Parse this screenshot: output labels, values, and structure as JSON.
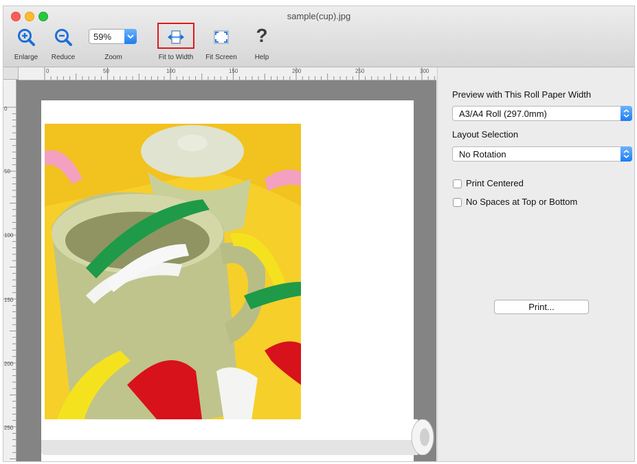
{
  "window": {
    "title": "sample(cup).jpg"
  },
  "toolbar": {
    "enlarge_label": "Enlarge",
    "reduce_label": "Reduce",
    "zoom_label": "Zoom",
    "zoom_value": "59%",
    "fit_width_label": "Fit to Width",
    "fit_screen_label": "Fit Screen",
    "help_label": "Help",
    "help_glyph": "?"
  },
  "rulers": {
    "horizontal": [
      "0",
      "50",
      "100",
      "150",
      "200",
      "250",
      "300"
    ],
    "vertical": [
      "0",
      "50",
      "100",
      "150",
      "200",
      "250"
    ]
  },
  "panel": {
    "roll_width_label": "Preview with This Roll Paper Width",
    "roll_width_value": "A3/A4 Roll (297.0mm)",
    "layout_label": "Layout Selection",
    "layout_value": "No Rotation",
    "print_centered_label": "Print Centered",
    "print_centered_checked": false,
    "no_spaces_label": "No Spaces at Top or Bottom",
    "no_spaces_checked": false,
    "print_button_label": "Print..."
  },
  "colors": {
    "accent": "#1d7cf2",
    "highlight_box": "#e2161c",
    "photo_background": "#f6cf2a"
  },
  "icons": {
    "enlarge": "zoom-in-icon",
    "reduce": "zoom-out-icon",
    "fit_width": "fit-width-icon",
    "fit_screen": "fit-screen-icon",
    "help": "help-icon"
  }
}
